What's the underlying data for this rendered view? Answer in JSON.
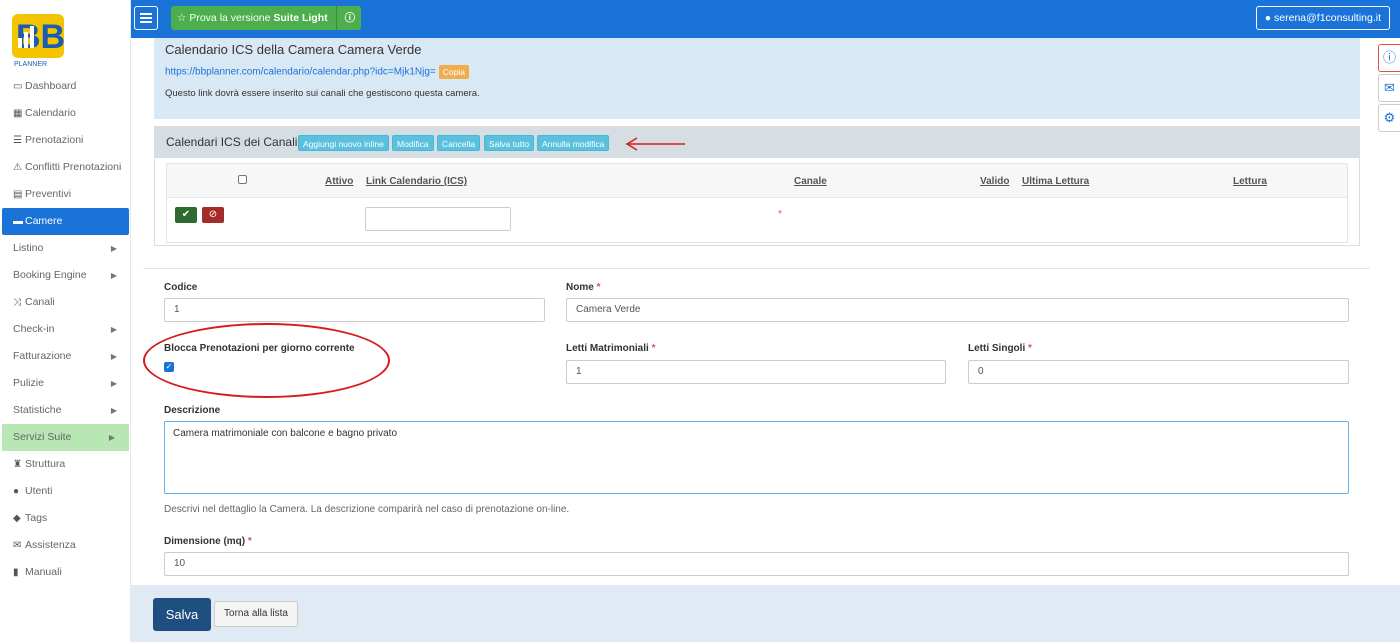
{
  "sidebar": {
    "logo_text": "PLANNER",
    "items": [
      {
        "label": "Dashboard",
        "icon": "dashboard-icon"
      },
      {
        "label": "Calendario",
        "icon": "calendar-icon"
      },
      {
        "label": "Prenotazioni",
        "icon": "list-icon"
      },
      {
        "label": "Conflitti Prenotazioni",
        "icon": "warning-icon"
      },
      {
        "label": "Preventivi",
        "icon": "document-icon"
      },
      {
        "label": "Camere",
        "icon": "bed-icon"
      },
      {
        "label": "Listino"
      },
      {
        "label": "Booking Engine"
      },
      {
        "label": "Canali",
        "icon": "random-icon"
      },
      {
        "label": "Check-in"
      },
      {
        "label": "Fatturazione"
      },
      {
        "label": "Pulizie"
      },
      {
        "label": "Statistiche"
      },
      {
        "label": "Servizi Suite"
      },
      {
        "label": "Struttura",
        "icon": "tower-icon"
      },
      {
        "label": "Utenti",
        "icon": "user-icon"
      },
      {
        "label": "Tags",
        "icon": "tags-icon"
      },
      {
        "label": "Assistenza",
        "icon": "envelope-icon"
      },
      {
        "label": "Manuali",
        "icon": "book-icon"
      }
    ]
  },
  "topbar": {
    "suite_button": "Prova la versione",
    "suite_button_bold": "Suite Light",
    "user": "serena@f1consulting.it"
  },
  "ics": {
    "title": "Calendario ICS della Camera Camera Verde",
    "link": "https://bbplanner.com/calendario/calendar.php?idc=Mjk1Njg=",
    "copy_label": "Copia",
    "note": "Questo link dovrà essere inserito sui canali che gestiscono questa camera."
  },
  "canali": {
    "title": "Calendari ICS dei Canali",
    "buttons": [
      "Aggiungi nuovo inline",
      "Modifica",
      "Cancella",
      "Salva tutto",
      "Annulla modifica"
    ],
    "columns": [
      "Attivo",
      "Link Calendario (ICS)",
      "Canale",
      "Valido",
      "Ultima Lettura",
      "Lettura"
    ]
  },
  "form": {
    "codice_label": "Codice",
    "codice_value": "1",
    "nome_label": "Nome",
    "nome_value": "Camera Verde",
    "blocca_label": "Blocca Prenotazioni per giorno corrente",
    "letti_matr_label": "Letti Matrimoniali",
    "letti_matr_value": "1",
    "letti_sing_label": "Letti Singoli",
    "letti_sing_value": "0",
    "descrizione_label": "Descrizione",
    "descrizione_value": "Camera matrimoniale con balcone e bagno privato",
    "descrizione_help": "Descrivi nel dettaglio la Camera. La descrizione comparirà nel caso di prenotazione on-line.",
    "dimensione_label": "Dimensione (mq)",
    "dimensione_value": "10",
    "required_mark": "*"
  },
  "footer": {
    "save": "Salva",
    "back": "Torna alla lista"
  },
  "colors": {
    "primary": "#1a73d9",
    "suite_green": "#4cae4c",
    "annotation_red": "#d61c1c"
  }
}
